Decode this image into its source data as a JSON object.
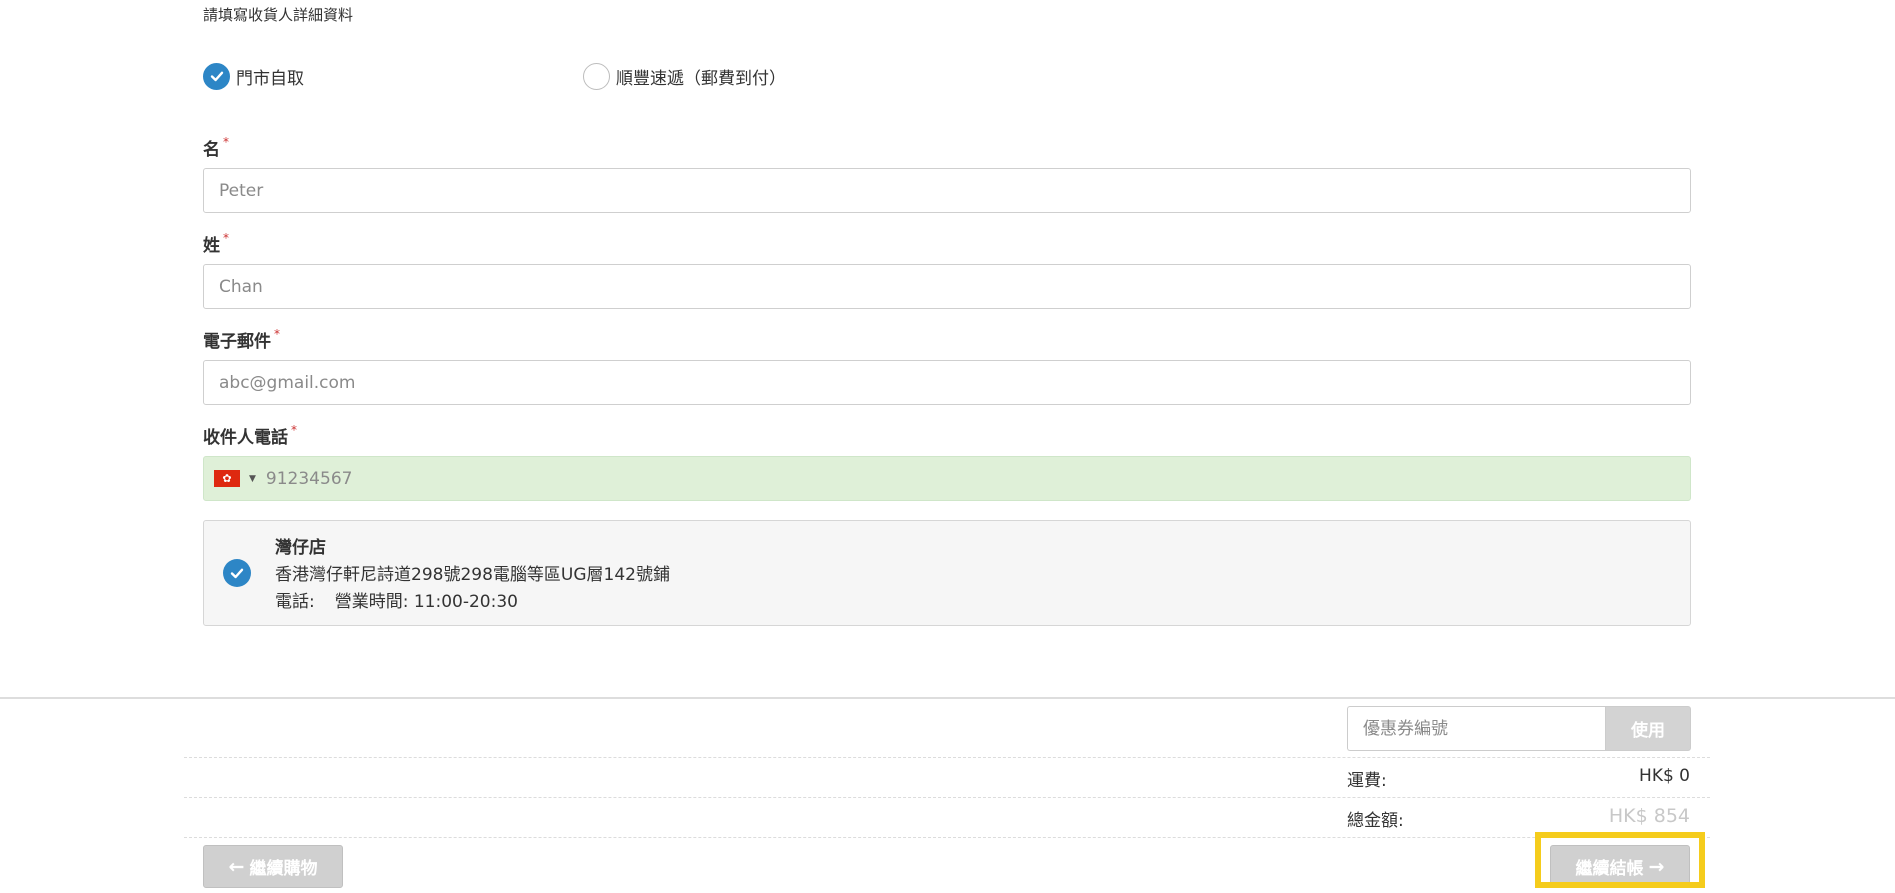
{
  "form": {
    "intro": "請填寫收貨人詳細資料",
    "delivery_options": [
      {
        "label": "門市自取",
        "checked": true
      },
      {
        "label": "順豐速遞（郵費到付）",
        "checked": false
      }
    ],
    "first_name": {
      "label": "名",
      "required_mark": "*",
      "placeholder": "Peter",
      "value": ""
    },
    "last_name": {
      "label": "姓",
      "required_mark": "*",
      "placeholder": "Chan",
      "value": ""
    },
    "email": {
      "label": "電子郵件",
      "required_mark": "*",
      "placeholder": "abc@gmail.com",
      "value": ""
    },
    "phone": {
      "label": "收件人電話",
      "required_mark": "*",
      "placeholder": "91234567",
      "value": "",
      "country_flag_icon": "hong-kong-flag-icon"
    }
  },
  "store": {
    "selected": true,
    "name": "灣仔店",
    "address": "香港灣仔軒尼詩道298號298電腦等區UG層142號鋪",
    "phone_label": "電話:",
    "hours_label": "營業時間: 11:00-20:30"
  },
  "summary": {
    "coupon_placeholder": "優惠券編號",
    "coupon_button": "使用",
    "shipping_label": "運費:",
    "shipping_value": "HK$ 0",
    "total_label": "總金額:",
    "total_value": "HK$ 854"
  },
  "actions": {
    "back_label": "繼續購物",
    "next_label": "繼續結帳"
  },
  "colors": {
    "accent": "#2d86c6",
    "highlight": "#f5cc1c",
    "phone_bg": "#dff0d8",
    "button_bg": "#d0d0d0"
  }
}
